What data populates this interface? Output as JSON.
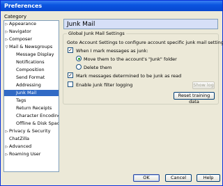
{
  "window": {
    "title": "Preferences"
  },
  "category_label": "Category",
  "tree": [
    {
      "label": "Appearance",
      "arrow": "▷"
    },
    {
      "label": "Navigator",
      "arrow": "▷"
    },
    {
      "label": "Composer",
      "arrow": "▷"
    },
    {
      "label": "Mail & Newsgroups",
      "arrow": "▽"
    },
    {
      "label": "Message Display",
      "arrow": ""
    },
    {
      "label": "Notifications",
      "arrow": ""
    },
    {
      "label": "Composition",
      "arrow": ""
    },
    {
      "label": "Send Format",
      "arrow": ""
    },
    {
      "label": "Addressing",
      "arrow": ""
    },
    {
      "label": "Junk Mail",
      "arrow": ""
    },
    {
      "label": "Tags",
      "arrow": ""
    },
    {
      "label": "Return Receipts",
      "arrow": ""
    },
    {
      "label": "Character Encoding",
      "arrow": ""
    },
    {
      "label": "Offline & Disk Space",
      "arrow": ""
    },
    {
      "label": "Privacy & Security",
      "arrow": "▷"
    },
    {
      "label": "ChatZilla",
      "arrow": ""
    },
    {
      "label": "Advanced",
      "arrow": "▷"
    },
    {
      "label": "Roaming User",
      "arrow": "▷"
    }
  ],
  "panel": {
    "title": "Junk Mail",
    "group_title": "Global Junk Mail Settings",
    "description": "Goto Account Settings to configure account specific junk mail settings.",
    "when_marked_label": "When I mark messages as junk:",
    "move_label": "Move them to the account's \"Junk\" folder",
    "delete_label": "Delete them",
    "mark_read_label": "Mark messages determined to be junk as read",
    "logging_label": "Enable junk filter logging",
    "show_log_label": "Show log",
    "reset_label": "Reset training data"
  },
  "footer": {
    "ok": "OK",
    "cancel": "Cancel",
    "help": "Help"
  }
}
